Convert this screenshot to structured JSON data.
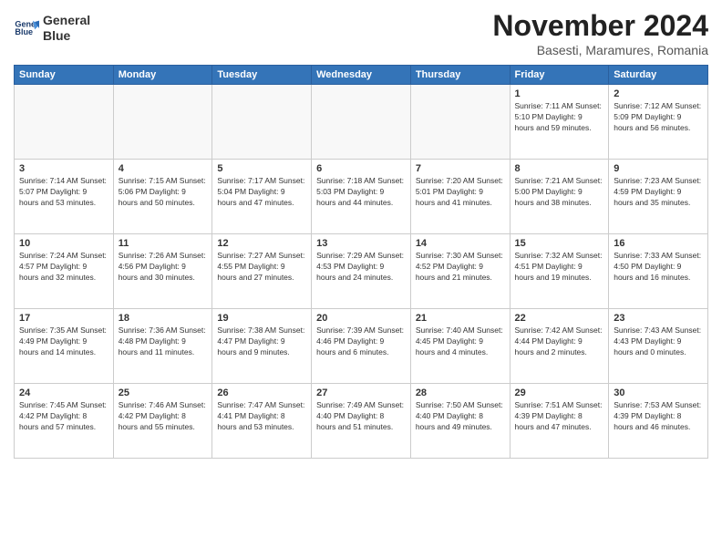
{
  "header": {
    "logo_line1": "General",
    "logo_line2": "Blue",
    "month": "November 2024",
    "location": "Basesti, Maramures, Romania"
  },
  "days_of_week": [
    "Sunday",
    "Monday",
    "Tuesday",
    "Wednesday",
    "Thursday",
    "Friday",
    "Saturday"
  ],
  "weeks": [
    [
      {
        "day": "",
        "info": ""
      },
      {
        "day": "",
        "info": ""
      },
      {
        "day": "",
        "info": ""
      },
      {
        "day": "",
        "info": ""
      },
      {
        "day": "",
        "info": ""
      },
      {
        "day": "1",
        "info": "Sunrise: 7:11 AM\nSunset: 5:10 PM\nDaylight: 9 hours and 59 minutes."
      },
      {
        "day": "2",
        "info": "Sunrise: 7:12 AM\nSunset: 5:09 PM\nDaylight: 9 hours and 56 minutes."
      }
    ],
    [
      {
        "day": "3",
        "info": "Sunrise: 7:14 AM\nSunset: 5:07 PM\nDaylight: 9 hours and 53 minutes."
      },
      {
        "day": "4",
        "info": "Sunrise: 7:15 AM\nSunset: 5:06 PM\nDaylight: 9 hours and 50 minutes."
      },
      {
        "day": "5",
        "info": "Sunrise: 7:17 AM\nSunset: 5:04 PM\nDaylight: 9 hours and 47 minutes."
      },
      {
        "day": "6",
        "info": "Sunrise: 7:18 AM\nSunset: 5:03 PM\nDaylight: 9 hours and 44 minutes."
      },
      {
        "day": "7",
        "info": "Sunrise: 7:20 AM\nSunset: 5:01 PM\nDaylight: 9 hours and 41 minutes."
      },
      {
        "day": "8",
        "info": "Sunrise: 7:21 AM\nSunset: 5:00 PM\nDaylight: 9 hours and 38 minutes."
      },
      {
        "day": "9",
        "info": "Sunrise: 7:23 AM\nSunset: 4:59 PM\nDaylight: 9 hours and 35 minutes."
      }
    ],
    [
      {
        "day": "10",
        "info": "Sunrise: 7:24 AM\nSunset: 4:57 PM\nDaylight: 9 hours and 32 minutes."
      },
      {
        "day": "11",
        "info": "Sunrise: 7:26 AM\nSunset: 4:56 PM\nDaylight: 9 hours and 30 minutes."
      },
      {
        "day": "12",
        "info": "Sunrise: 7:27 AM\nSunset: 4:55 PM\nDaylight: 9 hours and 27 minutes."
      },
      {
        "day": "13",
        "info": "Sunrise: 7:29 AM\nSunset: 4:53 PM\nDaylight: 9 hours and 24 minutes."
      },
      {
        "day": "14",
        "info": "Sunrise: 7:30 AM\nSunset: 4:52 PM\nDaylight: 9 hours and 21 minutes."
      },
      {
        "day": "15",
        "info": "Sunrise: 7:32 AM\nSunset: 4:51 PM\nDaylight: 9 hours and 19 minutes."
      },
      {
        "day": "16",
        "info": "Sunrise: 7:33 AM\nSunset: 4:50 PM\nDaylight: 9 hours and 16 minutes."
      }
    ],
    [
      {
        "day": "17",
        "info": "Sunrise: 7:35 AM\nSunset: 4:49 PM\nDaylight: 9 hours and 14 minutes."
      },
      {
        "day": "18",
        "info": "Sunrise: 7:36 AM\nSunset: 4:48 PM\nDaylight: 9 hours and 11 minutes."
      },
      {
        "day": "19",
        "info": "Sunrise: 7:38 AM\nSunset: 4:47 PM\nDaylight: 9 hours and 9 minutes."
      },
      {
        "day": "20",
        "info": "Sunrise: 7:39 AM\nSunset: 4:46 PM\nDaylight: 9 hours and 6 minutes."
      },
      {
        "day": "21",
        "info": "Sunrise: 7:40 AM\nSunset: 4:45 PM\nDaylight: 9 hours and 4 minutes."
      },
      {
        "day": "22",
        "info": "Sunrise: 7:42 AM\nSunset: 4:44 PM\nDaylight: 9 hours and 2 minutes."
      },
      {
        "day": "23",
        "info": "Sunrise: 7:43 AM\nSunset: 4:43 PM\nDaylight: 9 hours and 0 minutes."
      }
    ],
    [
      {
        "day": "24",
        "info": "Sunrise: 7:45 AM\nSunset: 4:42 PM\nDaylight: 8 hours and 57 minutes."
      },
      {
        "day": "25",
        "info": "Sunrise: 7:46 AM\nSunset: 4:42 PM\nDaylight: 8 hours and 55 minutes."
      },
      {
        "day": "26",
        "info": "Sunrise: 7:47 AM\nSunset: 4:41 PM\nDaylight: 8 hours and 53 minutes."
      },
      {
        "day": "27",
        "info": "Sunrise: 7:49 AM\nSunset: 4:40 PM\nDaylight: 8 hours and 51 minutes."
      },
      {
        "day": "28",
        "info": "Sunrise: 7:50 AM\nSunset: 4:40 PM\nDaylight: 8 hours and 49 minutes."
      },
      {
        "day": "29",
        "info": "Sunrise: 7:51 AM\nSunset: 4:39 PM\nDaylight: 8 hours and 47 minutes."
      },
      {
        "day": "30",
        "info": "Sunrise: 7:53 AM\nSunset: 4:39 PM\nDaylight: 8 hours and 46 minutes."
      }
    ]
  ]
}
